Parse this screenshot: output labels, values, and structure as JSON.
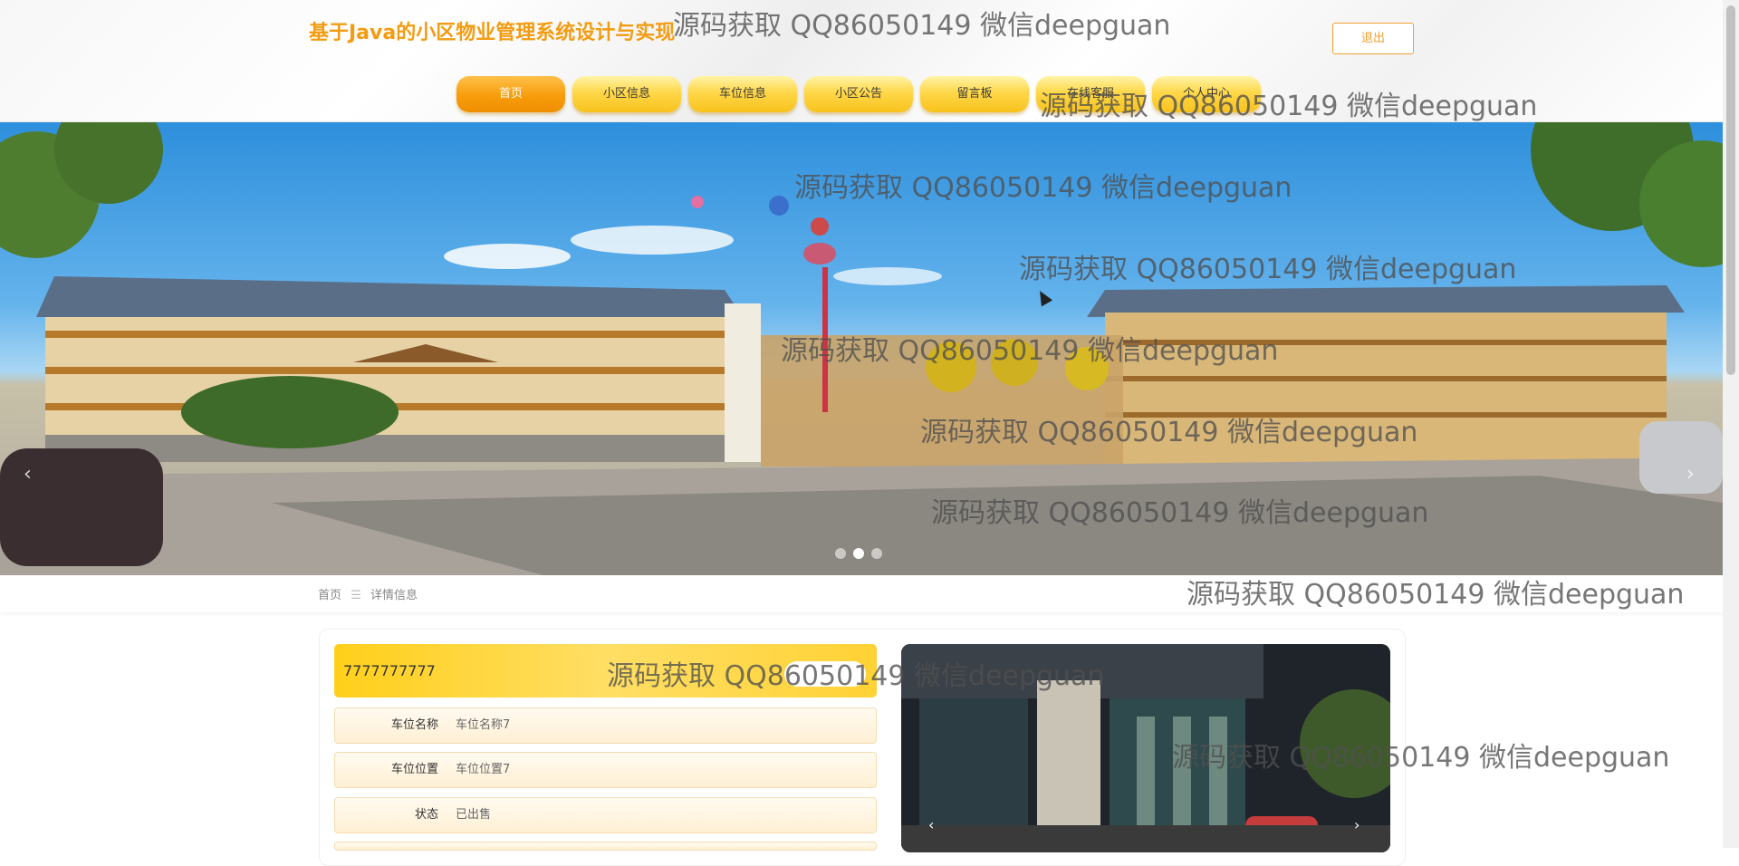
{
  "header": {
    "site_title": "基于Java的小区物业管理系统设计与实现",
    "logout_label": "退出"
  },
  "nav": {
    "items": [
      {
        "label": "首页",
        "active": true
      },
      {
        "label": "小区信息",
        "active": false
      },
      {
        "label": "车位信息",
        "active": false
      },
      {
        "label": "小区公告",
        "active": false
      },
      {
        "label": "留言板",
        "active": false
      },
      {
        "label": "在线客服",
        "active": false
      },
      {
        "label": "个人中心",
        "active": false
      }
    ]
  },
  "banner": {
    "slide_count": 3,
    "active_slide": 2,
    "prev_icon": "chevron-left-icon",
    "next_icon": "chevron-right-icon"
  },
  "breadcrumb": {
    "home": "首页",
    "separator": "☰",
    "current": "详情信息"
  },
  "detail": {
    "title": "7777777777",
    "fields": [
      {
        "label": "车位名称",
        "value": "车位名称7"
      },
      {
        "label": "车位位置",
        "value": "车位位置7"
      },
      {
        "label": "状态",
        "value": "已出售"
      }
    ],
    "image_prev_icon": "chevron-left-icon",
    "image_next_icon": "chevron-right-icon"
  },
  "watermarks": [
    "源码获取 QQ86050149 微信deepguan",
    "源码获取 QQ86050149 微信deepguan",
    "源码获取 QQ86050149 微信deepguan",
    "源码获取 QQ86050149 微信deepguan",
    "源码获取 QQ86050149 微信deepguan",
    "源码获取 QQ86050149 微信deepguan",
    "源码获取 QQ86050149 微信deepguan",
    "源码获取 QQ86050149 微信deepguan",
    "源码获取 QQ86050149 微信deepguan",
    "源码获取 QQ86050149 微信deepguan"
  ],
  "colors": {
    "brand": "#f39c12",
    "nav_gradient_top": "#fff4a8",
    "nav_gradient_bottom": "#f7c21c",
    "nav_active": "#f79d0c"
  }
}
